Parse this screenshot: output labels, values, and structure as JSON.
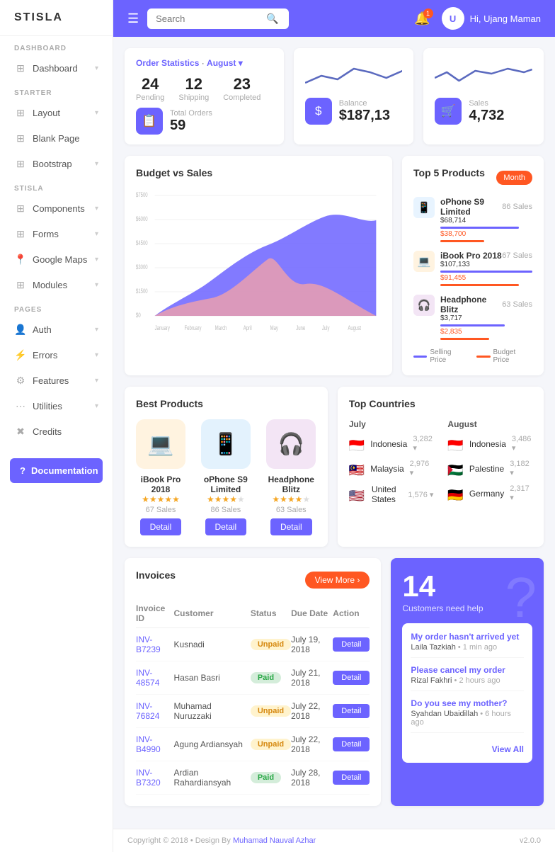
{
  "sidebar": {
    "logo": "STISLA",
    "sections": [
      {
        "label": "DASHBOARD",
        "items": [
          {
            "id": "dashboard",
            "label": "Dashboard",
            "icon": "⊞",
            "hasArrow": true
          }
        ]
      },
      {
        "label": "STARTER",
        "items": [
          {
            "id": "layout",
            "label": "Layout",
            "icon": "⊞",
            "hasArrow": true
          },
          {
            "id": "blank-page",
            "label": "Blank Page",
            "icon": "⊞",
            "hasArrow": false
          },
          {
            "id": "bootstrap",
            "label": "Bootstrap",
            "icon": "⊞",
            "hasArrow": true
          }
        ]
      },
      {
        "label": "STISLA",
        "items": [
          {
            "id": "components",
            "label": "Components",
            "icon": "⊞",
            "hasArrow": true
          },
          {
            "id": "forms",
            "label": "Forms",
            "icon": "⊞",
            "hasArrow": true
          },
          {
            "id": "google-maps",
            "label": "Google Maps",
            "icon": "📍",
            "hasArrow": true
          },
          {
            "id": "modules",
            "label": "Modules",
            "icon": "⊞",
            "hasArrow": true
          }
        ]
      },
      {
        "label": "PAGES",
        "items": [
          {
            "id": "auth",
            "label": "Auth",
            "icon": "👤",
            "hasArrow": true
          },
          {
            "id": "errors",
            "label": "Errors",
            "icon": "⚠",
            "hasArrow": true
          },
          {
            "id": "features",
            "label": "Features",
            "icon": "🔧",
            "hasArrow": true
          },
          {
            "id": "utilities",
            "label": "Utilities",
            "icon": "⋯",
            "hasArrow": true
          }
        ]
      }
    ],
    "credits_label": "Credits",
    "documentation_label": "Documentation"
  },
  "topbar": {
    "search_placeholder": "Search",
    "notification_count": "1",
    "user_name": "Hi, Ujang Maman",
    "user_initials": "U"
  },
  "stats": {
    "order_statistics_label": "Order Statistics",
    "month": "August",
    "pending_count": "24",
    "pending_label": "Pending",
    "shipping_count": "12",
    "shipping_label": "Shipping",
    "completed_count": "23",
    "completed_label": "Completed",
    "total_orders_label": "Total Orders",
    "total_orders_value": "59",
    "balance_label": "Balance",
    "balance_value": "$187,13",
    "sales_label": "Sales",
    "sales_value": "4,732"
  },
  "budget_chart": {
    "title": "Budget vs Sales",
    "y_labels": [
      "$7500",
      "$6000",
      "$4500",
      "$3000",
      "$1500",
      "$0"
    ],
    "x_labels": [
      "January",
      "February",
      "March",
      "April",
      "May",
      "June",
      "July",
      "August"
    ]
  },
  "top_products": {
    "title": "Top 5 Products",
    "month_btn": "Month",
    "items": [
      {
        "name": "oPhone S9 Limited",
        "sales": "86 Sales",
        "selling_price": "$68,714",
        "budget_price": "$38,700",
        "selling_pct": 85,
        "budget_pct": 48,
        "icon": "📱",
        "color": "blue"
      },
      {
        "name": "iBook Pro 2018",
        "sales": "67 Sales",
        "selling_price": "$107,133",
        "budget_price": "$91,455",
        "selling_pct": 100,
        "budget_pct": 85,
        "icon": "💻",
        "color": "orange"
      },
      {
        "name": "Headphone Blitz",
        "sales": "63 Sales",
        "selling_price": "$3,717",
        "budget_price": "$2,835",
        "selling_pct": 70,
        "budget_pct": 53,
        "icon": "🎧",
        "color": "purple"
      }
    ],
    "legend_selling": "Selling Price",
    "legend_budget": "Budget Price"
  },
  "best_products": {
    "title": "Best Products",
    "items": [
      {
        "name": "iBook Pro 2018",
        "stars": 5,
        "sales": "67 Sales",
        "icon": "💻",
        "color": "orange"
      },
      {
        "name": "oPhone S9 Limited",
        "stars": 4,
        "sales": "86 Sales",
        "icon": "📱",
        "color": "blue"
      },
      {
        "name": "Headphone Blitz",
        "stars": 4,
        "sales": "63 Sales",
        "icon": "🎧",
        "color": "purple"
      }
    ],
    "detail_btn": "Detail"
  },
  "top_countries": {
    "title": "Top Countries",
    "july_label": "July",
    "august_label": "August",
    "july_countries": [
      {
        "name": "Indonesia",
        "count": "3,282 ▾",
        "flag": "🇮🇩"
      },
      {
        "name": "Malaysia",
        "count": "2,976 ▾",
        "flag": "🇲🇾"
      },
      {
        "name": "United States",
        "count": "1,576 ▾",
        "flag": "🇺🇸"
      }
    ],
    "august_countries": [
      {
        "name": "Indonesia",
        "count": "3,486 ▾",
        "flag": "🇮🇩"
      },
      {
        "name": "Palestine",
        "count": "3,182 ▾",
        "flag": "🇵🇸"
      },
      {
        "name": "Germany",
        "count": "2,317 ▾",
        "flag": "🇩🇪"
      }
    ]
  },
  "invoices": {
    "title": "Invoices",
    "view_more_btn": "View More",
    "columns": [
      "Invoice ID",
      "Customer",
      "Status",
      "Due Date",
      "Action"
    ],
    "rows": [
      {
        "id": "INV-B7239",
        "customer": "Kusnadi",
        "status": "Unpaid",
        "status_type": "unpaid",
        "due_date": "July 19, 2018",
        "action": "Detail"
      },
      {
        "id": "INV-48574",
        "customer": "Hasan Basri",
        "status": "Paid",
        "status_type": "paid",
        "due_date": "July 21, 2018",
        "action": "Detail"
      },
      {
        "id": "INV-76824",
        "customer": "Muhamad Nuruzzaki",
        "status": "Unpaid",
        "status_type": "unpaid",
        "due_date": "July 22, 2018",
        "action": "Detail"
      },
      {
        "id": "INV-B4990",
        "customer": "Agung Ardiansyah",
        "status": "Unpaid",
        "status_type": "unpaid",
        "due_date": "July 22, 2018",
        "action": "Detail"
      },
      {
        "id": "INV-B7320",
        "customer": "Ardian Rahardiansyah",
        "status": "Paid",
        "status_type": "paid",
        "due_date": "July 28, 2018",
        "action": "Detail"
      }
    ]
  },
  "help": {
    "count": "14",
    "label": "Customers need help",
    "messages": [
      {
        "title": "My order hasn't arrived yet",
        "author": "Laila Tazkiah",
        "time": "1 min ago"
      },
      {
        "title": "Please cancel my order",
        "author": "Rizal Fakhri",
        "time": "2 hours ago"
      },
      {
        "title": "Do you see my mother?",
        "author": "Syahdan Ubaidillah",
        "time": "6 hours ago"
      }
    ],
    "view_all": "View All"
  },
  "footer": {
    "copyright": "Copyright © 2018  •  Design By",
    "author": "Muhamad Nauval Azhar",
    "version": "v2.0.0"
  }
}
